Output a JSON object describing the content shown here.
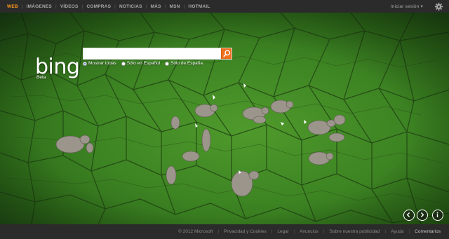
{
  "nav": {
    "items": [
      {
        "label": "WEB",
        "active": true
      },
      {
        "label": "IMÁGENES"
      },
      {
        "label": "VÍDEOS"
      },
      {
        "label": "COMPRAS"
      },
      {
        "label": "NOTICIAS"
      },
      {
        "label": "MÁS"
      },
      {
        "label": "MSN"
      },
      {
        "label": "HOTMAIL"
      }
    ],
    "signin": "Iniciar sesión ▾",
    "settings_icon": "gear-icon"
  },
  "logo": {
    "text": "bing",
    "sub": "Beta"
  },
  "search": {
    "value": "",
    "placeholder": "",
    "button_icon": "magnifier-icon",
    "options": [
      {
        "label": "Mostrar todas",
        "selected": true
      },
      {
        "label": "Sólo en Español",
        "selected": false
      },
      {
        "label": "Sólo de España",
        "selected": false
      }
    ]
  },
  "image_nav": {
    "prev_icon": "chevron-left-icon",
    "next_icon": "chevron-right-icon",
    "info_icon": "info-icon"
  },
  "footer": {
    "copyright": "© 2012 Microsoft",
    "links": [
      "Privacidad y Cookies",
      "Legal",
      "Anuncios",
      "Sobre nuestra publicidad",
      "Ayuda",
      "Comentarios"
    ]
  },
  "colors": {
    "bar": "#2b2b2b",
    "active_nav": "#ff9a1a",
    "search_button": "#ef6f1c",
    "grass": "#3d8423"
  }
}
